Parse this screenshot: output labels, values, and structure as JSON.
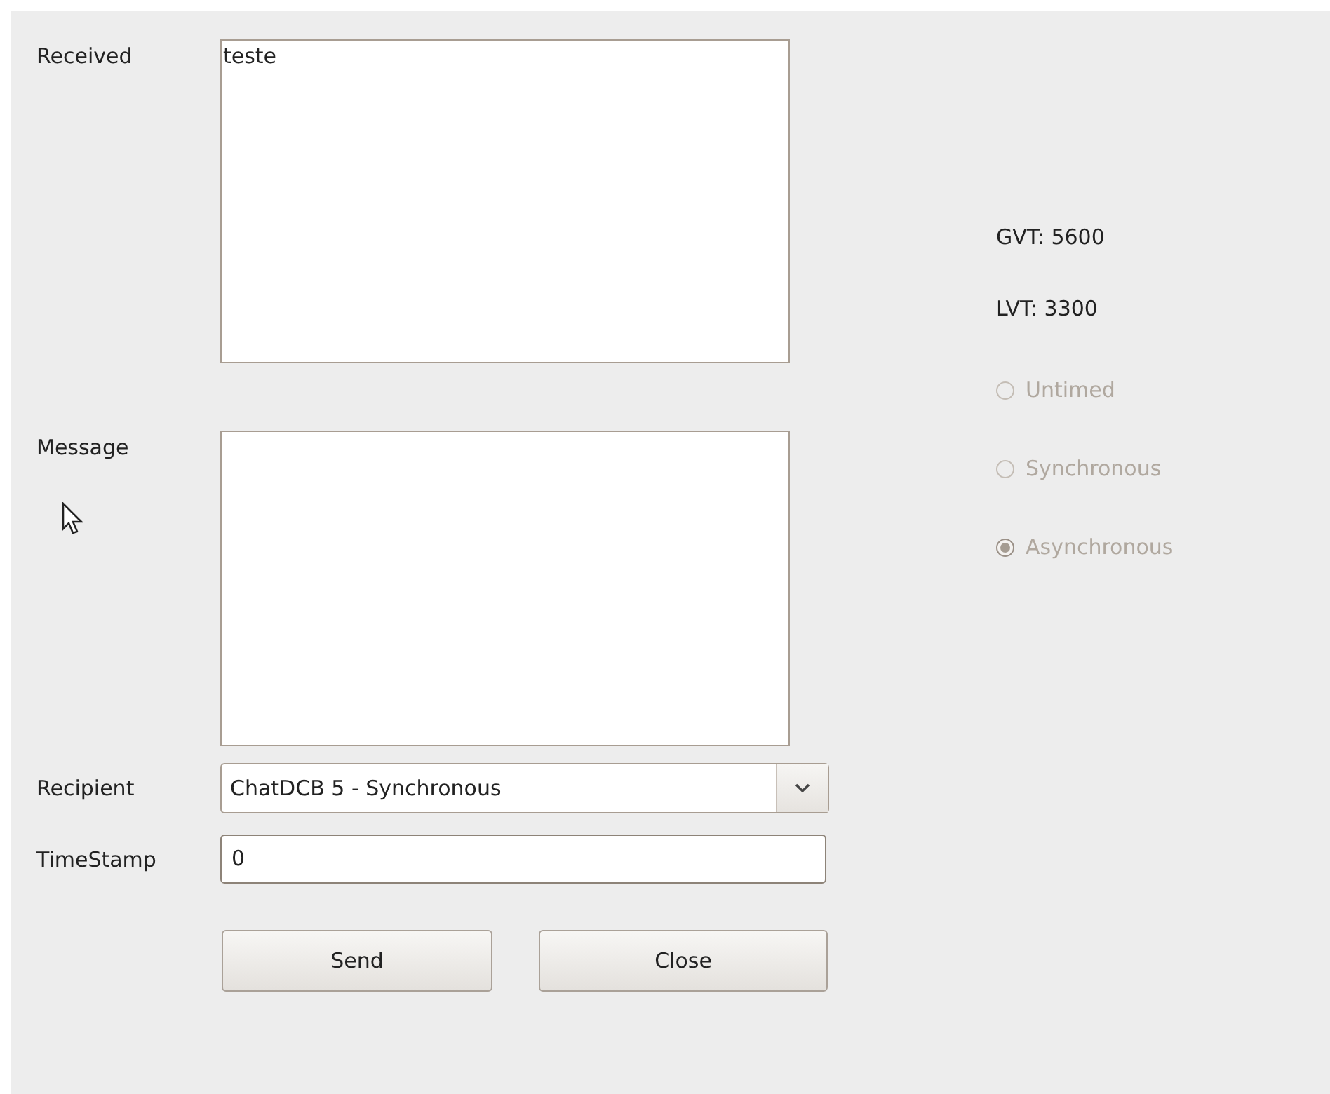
{
  "received": {
    "label": "Received",
    "value": "teste"
  },
  "message": {
    "label": "Message"
  },
  "recipient": {
    "label": "Recipient",
    "value": "ChatDCB 5 - Synchronous"
  },
  "timestamp": {
    "label": "TimeStamp",
    "value": "0"
  },
  "buttons": [
    "Send",
    "Close"
  ],
  "gvt": "GVT: 5600",
  "lvt": "LVT: 3300",
  "modes": [
    {
      "label": "Untimed",
      "selected": false,
      "disabled": true
    },
    {
      "label": "Synchronous",
      "selected": false,
      "disabled": true
    },
    {
      "label": "Asynchronous",
      "selected": true,
      "disabled": true
    }
  ]
}
